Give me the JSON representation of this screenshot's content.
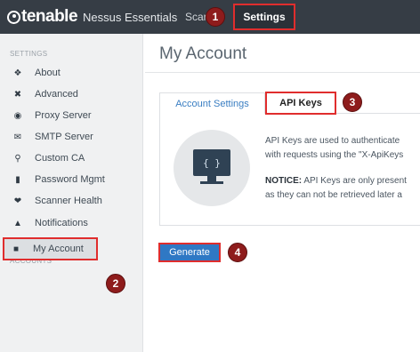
{
  "header": {
    "logo_text": "tenable",
    "logo_sub": "Nessus Essentials",
    "nav_scans": "Scar",
    "nav_settings": "Settings"
  },
  "sidebar": {
    "settings_label": "SETTINGS",
    "accounts_label": "ACCOUNTS",
    "items": [
      {
        "label": "About",
        "icon": "info-icon"
      },
      {
        "label": "Advanced",
        "icon": "tools-icon"
      },
      {
        "label": "Proxy Server",
        "icon": "globe-icon"
      },
      {
        "label": "SMTP Server",
        "icon": "mail-icon"
      },
      {
        "label": "Custom CA",
        "icon": "certificate-icon"
      },
      {
        "label": "Password Mgmt",
        "icon": "lock-icon"
      },
      {
        "label": "Scanner Health",
        "icon": "heartbeat-icon"
      },
      {
        "label": "Notifications",
        "icon": "bell-icon"
      }
    ],
    "account_item": {
      "label": "My Account",
      "icon": "user-icon"
    }
  },
  "main": {
    "title": "My Account",
    "tabs": [
      {
        "label": "Account Settings"
      },
      {
        "label": "API Keys"
      }
    ],
    "description": {
      "line1": "API Keys are used to authenticate",
      "line2": "with requests using the \"X-ApiKeys",
      "notice_label": "NOTICE:",
      "notice_line1": " API Keys are only present",
      "notice_line2": "as they can not be retrieved later a"
    },
    "api_glyph": "{ }",
    "generate_label": "Generate"
  },
  "callouts": [
    "1",
    "2",
    "3",
    "4"
  ],
  "colors": {
    "highlight": "#e02d2d",
    "callout": "#8e1c1c",
    "topbar": "#363d45",
    "primary_button": "#2f78c4"
  }
}
